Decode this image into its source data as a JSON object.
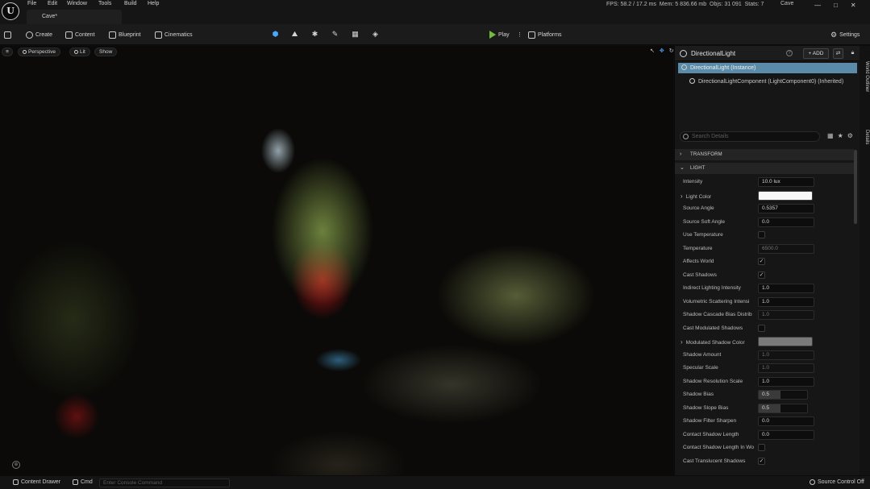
{
  "menu": [
    "File",
    "Edit",
    "Window",
    "Tools",
    "Build",
    "Help"
  ],
  "level_tab": "Cave*",
  "stats": {
    "fps": "FPS: 58.2",
    "ms": "17.2 ms",
    "mem": "Mem: 5 836.66 mb",
    "objs": "Objs: 31 091",
    "stats": "Stats: 7"
  },
  "project_name": "Cave",
  "window_controls": [
    "—",
    "□",
    "✕"
  ],
  "toolbar": {
    "create": "Create",
    "content": "Content",
    "blueprint": "Blueprint",
    "cinematics": "Cinematics",
    "play": "Play",
    "platforms": "Platforms",
    "settings": "Settings"
  },
  "viewport": {
    "menu_icon": "≡",
    "perspective": "Perspective",
    "lit": "Lit",
    "show": "Show"
  },
  "details": {
    "title": "DirectionalLight",
    "add_label": "+ ADD",
    "components": [
      "DirectionalLight (Instance)",
      "DirectionalLightComponent (LightComponent0) (Inherited)"
    ],
    "search_placeholder": "Search Details",
    "sections": {
      "transform": "TRANSFORM",
      "light": "LIGHT"
    },
    "properties": [
      {
        "label": "Intensity",
        "type": "value",
        "value": "10.0 lux"
      },
      {
        "label": "Light Color",
        "type": "color",
        "value": "#f7f7f7",
        "expandable": true
      },
      {
        "label": "Source Angle",
        "type": "value",
        "value": "0.5357"
      },
      {
        "label": "Source Soft Angle",
        "type": "value",
        "value": "0.0"
      },
      {
        "label": "Use Temperature",
        "type": "check",
        "value": ""
      },
      {
        "label": "Temperature",
        "type": "dim",
        "value": "6500.0"
      },
      {
        "label": "Affects World",
        "type": "check",
        "value": "✓"
      },
      {
        "label": "Cast Shadows",
        "type": "check",
        "value": "✓"
      },
      {
        "label": "Indirect Lighting Intensity",
        "type": "value",
        "value": "1.0"
      },
      {
        "label": "Volumetric Scattering Intensi",
        "type": "value",
        "value": "1.0"
      },
      {
        "label": "Shadow Cascade Bias Distrib",
        "type": "dim",
        "value": "1.0"
      },
      {
        "label": "Cast Modulated Shadows",
        "type": "check",
        "value": ""
      },
      {
        "label": "Modulated Shadow Color",
        "type": "color",
        "value": "#7a7a7a",
        "expandable": true
      },
      {
        "label": "Shadow Amount",
        "type": "dim",
        "value": "1.0"
      },
      {
        "label": "Specular Scale",
        "type": "dim",
        "value": "1.0"
      },
      {
        "label": "Shadow Resolution Scale",
        "type": "value",
        "value": "1.0"
      },
      {
        "label": "Shadow Bias",
        "type": "slider",
        "value": "0.5"
      },
      {
        "label": "Shadow Slope Bias",
        "type": "slider",
        "value": "0.5"
      },
      {
        "label": "Shadow Filter Sharpen",
        "type": "value",
        "value": "0.0"
      },
      {
        "label": "Contact Shadow Length",
        "type": "value",
        "value": "0.0"
      },
      {
        "label": "Contact Shadow Length In Wo",
        "type": "check",
        "value": ""
      },
      {
        "label": "Cast Translucent Shadows",
        "type": "check",
        "value": "✓"
      }
    ]
  },
  "side_tabs": {
    "outliner": "World Outliner",
    "details": "Details"
  },
  "bottom": {
    "content_drawer": "Content Drawer",
    "cmd": "Cmd",
    "console_placeholder": "Enter Console Command",
    "source_control": "Source Control Off"
  }
}
